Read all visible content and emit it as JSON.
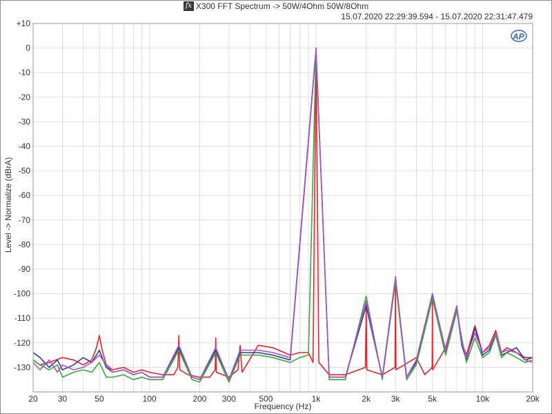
{
  "chart_data": {
    "type": "line",
    "title": "X300 FFT Spectrum -> 50W/4Ohm 50W/8Ohm",
    "subtitle": "15.07.2020 22:29:39.594 - 15.07.2020 22:31:47.479",
    "xlabel": "Frequency (Hz)",
    "ylabel": "Level -> Normalize (dBrA)",
    "xscale": "log",
    "xlim": [
      20,
      20000
    ],
    "ylim": [
      -140,
      10
    ],
    "grid": true,
    "xticks": [
      {
        "value": 20,
        "label": "20"
      },
      {
        "value": 30,
        "label": "30"
      },
      {
        "value": 50,
        "label": "50"
      },
      {
        "value": 100,
        "label": "100"
      },
      {
        "value": 200,
        "label": "200"
      },
      {
        "value": 300,
        "label": "300"
      },
      {
        "value": 500,
        "label": "500"
      },
      {
        "value": 1000,
        "label": "1k"
      },
      {
        "value": 2000,
        "label": "2k"
      },
      {
        "value": 3000,
        "label": "3k"
      },
      {
        "value": 5000,
        "label": "5k"
      },
      {
        "value": 10000,
        "label": "10k"
      },
      {
        "value": 20000,
        "label": "20k"
      }
    ],
    "yticks": [
      {
        "value": 10,
        "label": "+10"
      },
      {
        "value": 0,
        "label": "0"
      },
      {
        "value": -10,
        "label": "-10"
      },
      {
        "value": -20,
        "label": "-20"
      },
      {
        "value": -30,
        "label": "-30"
      },
      {
        "value": -40,
        "label": "-40"
      },
      {
        "value": -50,
        "label": "-50"
      },
      {
        "value": -60,
        "label": "-60"
      },
      {
        "value": -70,
        "label": "-70"
      },
      {
        "value": -80,
        "label": "-80"
      },
      {
        "value": -90,
        "label": "-90"
      },
      {
        "value": -100,
        "label": "-100"
      },
      {
        "value": -110,
        "label": "-110"
      },
      {
        "value": -120,
        "label": "-120"
      },
      {
        "value": -130,
        "label": "-130"
      }
    ],
    "series": [
      {
        "color": "#e8212b",
        "points": [
          [
            20,
            -127
          ],
          [
            22,
            -129
          ],
          [
            25,
            -128
          ],
          [
            30,
            -126
          ],
          [
            35,
            -127
          ],
          [
            40,
            -129
          ],
          [
            45,
            -127
          ],
          [
            48,
            -122
          ],
          [
            50,
            -117
          ],
          [
            52,
            -123
          ],
          [
            55,
            -129
          ],
          [
            60,
            -131
          ],
          [
            70,
            -130
          ],
          [
            80,
            -132
          ],
          [
            90,
            -131
          ],
          [
            100,
            -132
          ],
          [
            120,
            -133
          ],
          [
            140,
            -133
          ],
          [
            148,
            -130
          ],
          [
            150,
            -117
          ],
          [
            152,
            -131
          ],
          [
            170,
            -133
          ],
          [
            200,
            -134
          ],
          [
            230,
            -134
          ],
          [
            248,
            -131
          ],
          [
            250,
            -118
          ],
          [
            252,
            -132
          ],
          [
            300,
            -134
          ],
          [
            340,
            -131
          ],
          [
            350,
            -121
          ],
          [
            360,
            -132
          ],
          [
            450,
            -121
          ],
          [
            550,
            -122
          ],
          [
            700,
            -125
          ],
          [
            800,
            -124
          ],
          [
            900,
            -124
          ],
          [
            960,
            -128
          ],
          [
            1000,
            0
          ],
          [
            1040,
            -128
          ],
          [
            1200,
            -133
          ],
          [
            1500,
            -133
          ],
          [
            1980,
            -130
          ],
          [
            2000,
            -104
          ],
          [
            2020,
            -131
          ],
          [
            2500,
            -133
          ],
          [
            2980,
            -130
          ],
          [
            3000,
            -93
          ],
          [
            3020,
            -131
          ],
          [
            4000,
            -126
          ],
          [
            4500,
            -133
          ],
          [
            4980,
            -130
          ],
          [
            5000,
            -100
          ],
          [
            5020,
            -131
          ],
          [
            6000,
            -122
          ],
          [
            7000,
            -105
          ],
          [
            7500,
            -120
          ],
          [
            8000,
            -125
          ],
          [
            9000,
            -113
          ],
          [
            10000,
            -124
          ],
          [
            11000,
            -121
          ],
          [
            12000,
            -115
          ],
          [
            13000,
            -124
          ],
          [
            14000,
            -122
          ],
          [
            16000,
            -124
          ],
          [
            18000,
            -126
          ],
          [
            20000,
            -126
          ]
        ]
      },
      {
        "color": "#2e3ba0",
        "points": [
          [
            20,
            -124
          ],
          [
            22,
            -126
          ],
          [
            25,
            -130
          ],
          [
            28,
            -127
          ],
          [
            30,
            -131
          ],
          [
            35,
            -129
          ],
          [
            40,
            -126
          ],
          [
            45,
            -128
          ],
          [
            48,
            -125
          ],
          [
            50,
            -123
          ],
          [
            52,
            -126
          ],
          [
            55,
            -130
          ],
          [
            60,
            -132
          ],
          [
            70,
            -131
          ],
          [
            80,
            -133
          ],
          [
            90,
            -132
          ],
          [
            100,
            -134
          ],
          [
            120,
            -134
          ],
          [
            150,
            -122
          ],
          [
            180,
            -134
          ],
          [
            200,
            -135
          ],
          [
            250,
            -123
          ],
          [
            300,
            -135
          ],
          [
            350,
            -124
          ],
          [
            450,
            -124
          ],
          [
            550,
            -125
          ],
          [
            700,
            -127
          ],
          [
            1000,
            -1
          ],
          [
            1200,
            -134
          ],
          [
            1500,
            -134
          ],
          [
            2000,
            -105
          ],
          [
            2500,
            -134
          ],
          [
            3000,
            -94
          ],
          [
            3500,
            -134
          ],
          [
            4000,
            -128
          ],
          [
            5000,
            -101
          ],
          [
            6000,
            -124
          ],
          [
            7000,
            -106
          ],
          [
            7500,
            -121
          ],
          [
            8000,
            -127
          ],
          [
            9000,
            -114
          ],
          [
            10000,
            -125
          ],
          [
            11000,
            -123
          ],
          [
            12000,
            -116
          ],
          [
            13000,
            -125
          ],
          [
            14000,
            -124
          ],
          [
            16000,
            -122
          ],
          [
            18000,
            -127
          ],
          [
            20000,
            -126
          ]
        ]
      },
      {
        "color": "#3aa83a",
        "points": [
          [
            20,
            -127
          ],
          [
            22,
            -129
          ],
          [
            25,
            -131
          ],
          [
            28,
            -129
          ],
          [
            30,
            -134
          ],
          [
            35,
            -132
          ],
          [
            40,
            -131
          ],
          [
            45,
            -132
          ],
          [
            50,
            -128
          ],
          [
            55,
            -134
          ],
          [
            60,
            -134
          ],
          [
            70,
            -133
          ],
          [
            80,
            -135
          ],
          [
            90,
            -134
          ],
          [
            100,
            -135
          ],
          [
            120,
            -135
          ],
          [
            150,
            -123
          ],
          [
            180,
            -135
          ],
          [
            200,
            -136
          ],
          [
            250,
            -124
          ],
          [
            300,
            -136
          ],
          [
            350,
            -125
          ],
          [
            450,
            -125
          ],
          [
            550,
            -126
          ],
          [
            700,
            -128
          ],
          [
            800,
            -126
          ],
          [
            900,
            -125
          ],
          [
            1000,
            -1
          ],
          [
            1200,
            -135
          ],
          [
            1500,
            -135
          ],
          [
            2000,
            -101
          ],
          [
            2500,
            -135
          ],
          [
            3000,
            -95
          ],
          [
            3500,
            -135
          ],
          [
            4000,
            -129
          ],
          [
            5000,
            -102
          ],
          [
            6000,
            -125
          ],
          [
            7000,
            -107
          ],
          [
            7500,
            -118
          ],
          [
            8000,
            -128
          ],
          [
            9000,
            -118
          ],
          [
            10000,
            -126
          ],
          [
            11000,
            -124
          ],
          [
            12000,
            -117
          ],
          [
            13000,
            -126
          ],
          [
            14000,
            -124
          ],
          [
            16000,
            -126
          ],
          [
            18000,
            -128
          ],
          [
            20000,
            -127
          ]
        ]
      },
      {
        "color": "#a855c8",
        "points": [
          [
            20,
            -128
          ],
          [
            22,
            -131
          ],
          [
            25,
            -127
          ],
          [
            28,
            -132
          ],
          [
            30,
            -129
          ],
          [
            35,
            -131
          ],
          [
            40,
            -130
          ],
          [
            45,
            -128
          ],
          [
            50,
            -125
          ],
          [
            55,
            -129
          ],
          [
            60,
            -132
          ],
          [
            70,
            -131
          ],
          [
            80,
            -133
          ],
          [
            90,
            -132
          ],
          [
            100,
            -134
          ],
          [
            120,
            -134
          ],
          [
            150,
            -121
          ],
          [
            180,
            -134
          ],
          [
            200,
            -135
          ],
          [
            250,
            -122
          ],
          [
            300,
            -135
          ],
          [
            350,
            -123
          ],
          [
            450,
            -123
          ],
          [
            550,
            -124
          ],
          [
            700,
            -126
          ],
          [
            1000,
            0
          ],
          [
            1200,
            -134
          ],
          [
            1500,
            -134
          ],
          [
            2000,
            -103
          ],
          [
            2500,
            -134
          ],
          [
            3000,
            -93
          ],
          [
            3500,
            -134
          ],
          [
            4000,
            -127
          ],
          [
            5000,
            -100
          ],
          [
            6000,
            -123
          ],
          [
            7000,
            -105
          ],
          [
            7500,
            -120
          ],
          [
            8000,
            -126
          ],
          [
            9000,
            -116
          ],
          [
            10000,
            -124
          ],
          [
            11000,
            -122
          ],
          [
            12000,
            -116
          ],
          [
            13000,
            -124
          ],
          [
            14000,
            -123
          ],
          [
            16000,
            -124
          ],
          [
            18000,
            -127
          ],
          [
            20000,
            -128
          ]
        ]
      }
    ]
  }
}
